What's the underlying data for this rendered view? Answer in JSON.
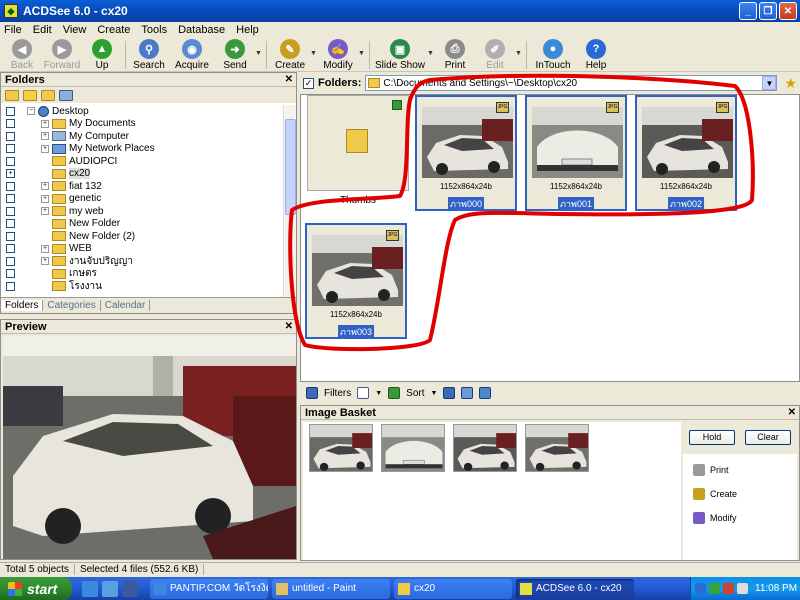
{
  "window": {
    "title": "ACDSee 6.0 - cx20",
    "min": "_",
    "max": "❐",
    "close": "✕"
  },
  "menu": [
    "File",
    "Edit",
    "View",
    "Create",
    "Tools",
    "Database",
    "Help"
  ],
  "toolbar": [
    {
      "label": "Back",
      "icon": "back-arrow-icon",
      "color": "#9a9a9a",
      "disabled": true,
      "glyph": "◀"
    },
    {
      "label": "Forward",
      "icon": "forward-arrow-icon",
      "color": "#9a9a9a",
      "disabled": true,
      "glyph": "▶"
    },
    {
      "label": "Up",
      "icon": "up-arrow-icon",
      "color": "#2ea02e",
      "disabled": false,
      "glyph": "▲"
    },
    {
      "label": "Search",
      "icon": "search-icon",
      "color": "#4a7ac8",
      "disabled": false,
      "glyph": "⚲"
    },
    {
      "label": "Acquire",
      "icon": "camera-icon",
      "color": "#5a8ad0",
      "disabled": false,
      "glyph": "◉"
    },
    {
      "label": "Send",
      "icon": "send-icon",
      "color": "#3a9a3a",
      "disabled": false,
      "glyph": "➜"
    },
    {
      "label": "Create",
      "icon": "create-wand-icon",
      "color": "#c8a020",
      "disabled": false,
      "glyph": "✎"
    },
    {
      "label": "Modify",
      "icon": "modify-icon",
      "color": "#7a5ac8",
      "disabled": false,
      "glyph": "✍"
    },
    {
      "label": "Slide Show",
      "icon": "slideshow-icon",
      "color": "#2a8a4a",
      "disabled": false,
      "glyph": "▣"
    },
    {
      "label": "Print",
      "icon": "printer-icon",
      "color": "#8a8a8a",
      "disabled": false,
      "glyph": "⎙"
    },
    {
      "label": "Edit",
      "icon": "edit-icon",
      "color": "#b0b0b0",
      "disabled": true,
      "glyph": "✐"
    },
    {
      "label": "InTouch",
      "icon": "intouch-globe-icon",
      "color": "#3a8ad8",
      "disabled": false,
      "glyph": "●"
    },
    {
      "label": "Help",
      "icon": "help-icon",
      "color": "#2a6ad8",
      "disabled": false,
      "glyph": "?"
    }
  ],
  "folders_panel": {
    "title": "Folders",
    "close": "✕",
    "tree": [
      {
        "label": "Desktop",
        "level": 0,
        "expand": "−",
        "icon": "desk",
        "check": ""
      },
      {
        "label": "My Documents",
        "level": 1,
        "expand": "+",
        "icon": "folder",
        "check": ""
      },
      {
        "label": "My Computer",
        "level": 1,
        "expand": "+",
        "icon": "comp",
        "check": ""
      },
      {
        "label": "My Network Places",
        "level": 1,
        "expand": "+",
        "icon": "net",
        "check": ""
      },
      {
        "label": "AUDIOPCI",
        "level": 1,
        "expand": "",
        "icon": "folder",
        "check": ""
      },
      {
        "label": "cx20",
        "level": 1,
        "expand": "",
        "icon": "folder",
        "check": "+",
        "selected": true
      },
      {
        "label": "fiat 132",
        "level": 1,
        "expand": "+",
        "icon": "folder",
        "check": ""
      },
      {
        "label": "genetic",
        "level": 1,
        "expand": "+",
        "icon": "folder",
        "check": ""
      },
      {
        "label": "my web",
        "level": 1,
        "expand": "+",
        "icon": "folder",
        "check": ""
      },
      {
        "label": "New Folder",
        "level": 1,
        "expand": "",
        "icon": "folder",
        "check": ""
      },
      {
        "label": "New Folder (2)",
        "level": 1,
        "expand": "",
        "icon": "folder",
        "check": ""
      },
      {
        "label": "WEB",
        "level": 1,
        "expand": "+",
        "icon": "folder",
        "check": ""
      },
      {
        "label": "งานจับปริญญา",
        "level": 1,
        "expand": "+",
        "icon": "folder",
        "check": ""
      },
      {
        "label": "เกษตร",
        "level": 1,
        "expand": "",
        "icon": "folder",
        "check": ""
      },
      {
        "label": "โรงงาน",
        "level": 1,
        "expand": "",
        "icon": "folder",
        "check": ""
      }
    ],
    "tabs": [
      "Folders",
      "Categories",
      "Calendar"
    ]
  },
  "preview_panel": {
    "title": "Preview",
    "close": "✕"
  },
  "address": {
    "label": "Folders:",
    "path": "C:\\Documents and Settings\\~\\Desktop\\cx20",
    "checked": "✓"
  },
  "files": {
    "folder_item": {
      "label": "Thumbs"
    },
    "images": [
      {
        "name": "ภาพ000",
        "size": "1152x864x24b",
        "tag": "JPG"
      },
      {
        "name": "ภาพ001",
        "size": "1152x864x24b",
        "tag": "JPG"
      },
      {
        "name": "ภาพ002",
        "size": "1152x864x24b",
        "tag": "JPG"
      },
      {
        "name": "ภาพ003",
        "size": "1152x864x24b",
        "tag": "JPG"
      }
    ]
  },
  "bottom_toolbar": {
    "filters": "Filters",
    "sort": "Sort"
  },
  "basket": {
    "title": "Image Basket",
    "close": "✕",
    "hold": "Hold",
    "clear": "Clear",
    "actions": [
      {
        "label": "Print",
        "icon": "printer-icon"
      },
      {
        "label": "Create",
        "icon": "create-wand-icon"
      },
      {
        "label": "Modify",
        "icon": "modify-icon"
      }
    ]
  },
  "status": {
    "total": "Total 5 objects",
    "selected": "Selected 4 files (552.6 KB)"
  },
  "taskbar": {
    "start": "start",
    "tasks": [
      {
        "label": "PANTIP.COM วัดโรงงิต...",
        "active": false
      },
      {
        "label": "untitled - Paint",
        "active": false
      },
      {
        "label": "cx20",
        "active": false
      },
      {
        "label": "ACDSee 6.0 - cx20",
        "active": true
      }
    ],
    "clock": "11:08 PM"
  },
  "colors": {
    "selection": "#3161c5",
    "annotation": "#e00000",
    "titlebar": "#0a4fc8"
  }
}
